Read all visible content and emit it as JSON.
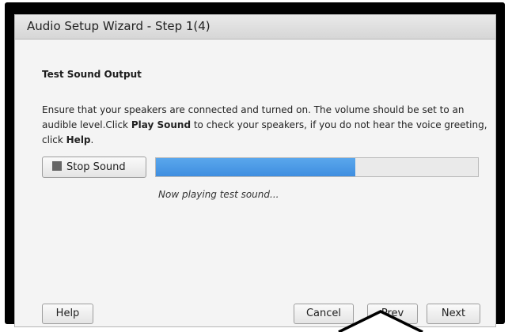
{
  "window": {
    "title": "Audio Setup Wizard - Step 1(4)"
  },
  "content": {
    "heading": "Test Sound Output",
    "description": {
      "part1": "Ensure that your speakers are connected and turned on. The volume should be set to an audible level.Click ",
      "play_sound": "Play Sound",
      "part2": " to check your speakers, if you do not hear the voice greeting, click ",
      "help": "Help",
      "part3": "."
    },
    "stop_button_label": "Stop Sound",
    "stop_icon": "stop-icon",
    "progress": {
      "fraction": 0.62,
      "fill_color": "#4a9be8"
    },
    "status_text": "Now playing test sound..."
  },
  "footer": {
    "help_label": "Help",
    "cancel_label": "Cancel",
    "prev_label": "Prev",
    "next_label": "Next"
  }
}
